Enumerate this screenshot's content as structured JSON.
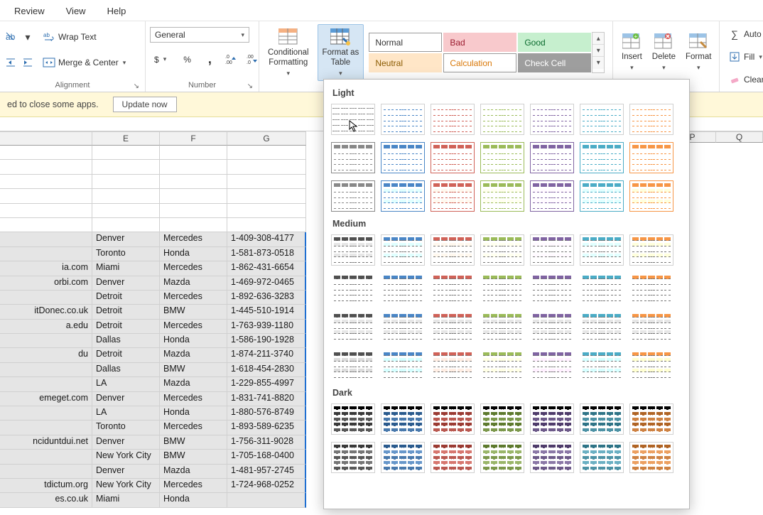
{
  "menu": {
    "review": "Review",
    "view": "View",
    "help": "Help"
  },
  "ribbon": {
    "wrap": "Wrap Text",
    "merge": "Merge & Center",
    "align_label": "Alignment",
    "number_label": "Number",
    "numfmt": "General",
    "currency": "$",
    "percent": "%",
    "comma": ",",
    "inc_dec": "",
    "cond": "Conditional\nFormatting",
    "fmt_table": "Format as\nTable",
    "insert": "Insert",
    "delete": "Delete",
    "format": "Format",
    "autosum": "Auto",
    "fill": "Fill",
    "clear": "Clear"
  },
  "styles": {
    "normal": "Normal",
    "bad": "Bad",
    "good": "Good",
    "neutral": "Neutral",
    "calc": "Calculation",
    "check": "Check Cell"
  },
  "notif": {
    "msg": "ed to close some apps.",
    "btn": "Update now"
  },
  "popup": {
    "light": "Light",
    "medium": "Medium",
    "dark": "Dark",
    "light_colors": [
      "#888888",
      "#4a86c6",
      "#d06258",
      "#9bbb59",
      "#8064a2",
      "#4bacc6",
      "#f79646"
    ],
    "medium_colors": [
      "#505050",
      "#4a86c6",
      "#d06258",
      "#9bbb59",
      "#8064a2",
      "#4bacc6",
      "#f79646"
    ],
    "dark_colors": [
      "#3a3a3a",
      "#2b5b8e",
      "#9b3b33",
      "#5e7a2e",
      "#4f3c6b",
      "#2f7487",
      "#b06425"
    ]
  },
  "columns": {
    "E": "E",
    "F": "F",
    "G": "G",
    "P": "P",
    "Q": "Q"
  },
  "rows": [
    {
      "d": "",
      "e": "Denver",
      "f": "Mercedes",
      "g": "1-409-308-4177"
    },
    {
      "d": "",
      "e": "Toronto",
      "f": "Honda",
      "g": "1-581-873-0518"
    },
    {
      "d": "ia.com",
      "e": "Miami",
      "f": "Mercedes",
      "g": "1-862-431-6654"
    },
    {
      "d": "orbi.com",
      "e": "Denver",
      "f": "Mazda",
      "g": "1-469-972-0465"
    },
    {
      "d": "",
      "e": "Detroit",
      "f": "Mercedes",
      "g": "1-892-636-3283"
    },
    {
      "d": "itDonec.co.uk",
      "e": "Detroit",
      "f": "BMW",
      "g": "1-445-510-1914"
    },
    {
      "d": "a.edu",
      "e": "Detroit",
      "f": "Mercedes",
      "g": "1-763-939-1180"
    },
    {
      "d": "",
      "e": "Dallas",
      "f": "Honda",
      "g": "1-586-190-1928"
    },
    {
      "d": "du",
      "e": "Detroit",
      "f": "Mazda",
      "g": "1-874-211-3740"
    },
    {
      "d": "",
      "e": "Dallas",
      "f": "BMW",
      "g": "1-618-454-2830"
    },
    {
      "d": "",
      "e": "LA",
      "f": "Mazda",
      "g": "1-229-855-4997"
    },
    {
      "d": "emeget.com",
      "e": "Denver",
      "f": "Mercedes",
      "g": "1-831-741-8820"
    },
    {
      "d": "",
      "e": "LA",
      "f": "Honda",
      "g": "1-880-576-8749"
    },
    {
      "d": "",
      "e": "Toronto",
      "f": "Mercedes",
      "g": "1-893-589-6235"
    },
    {
      "d": "nciduntdui.net",
      "e": "Denver",
      "f": "BMW",
      "g": "1-756-311-9028"
    },
    {
      "d": "",
      "e": "New York City",
      "f": "BMW",
      "g": "1-705-168-0400"
    },
    {
      "d": "",
      "e": "Denver",
      "f": "Mazda",
      "g": "1-481-957-2745"
    },
    {
      "d": "tdictum.org",
      "e": "New York City",
      "f": "Mercedes",
      "g": "1-724-968-0252"
    },
    {
      "d": "es.co.uk",
      "e": "Miami",
      "f": "Honda",
      "g": ""
    }
  ]
}
